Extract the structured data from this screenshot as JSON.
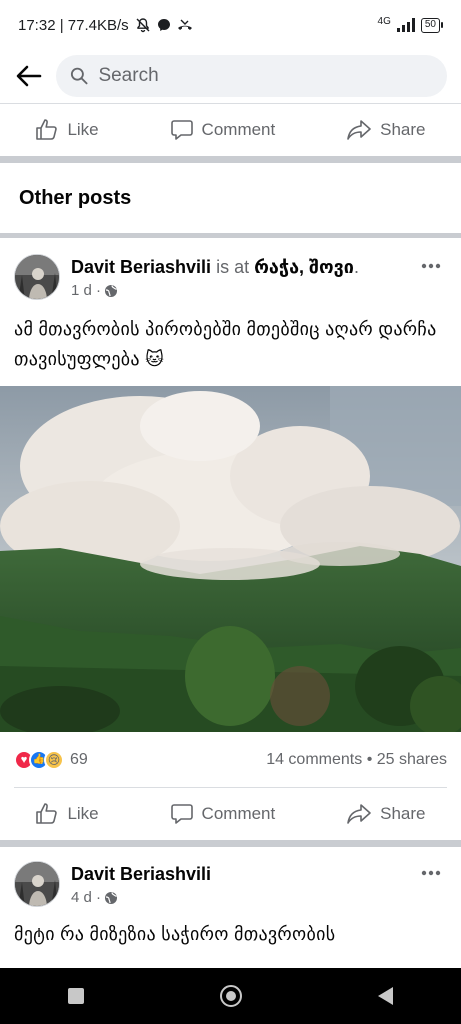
{
  "status": {
    "time_net": "17:32 | 77.4KB/s",
    "network": "4G",
    "battery": "50"
  },
  "search": {
    "placeholder": "Search"
  },
  "actions": {
    "like": "Like",
    "comment": "Comment",
    "share": "Share"
  },
  "section": {
    "title": "Other posts"
  },
  "posts": [
    {
      "author": "Davit Beriashvili",
      "is_at": "is at",
      "location": "რაჭა, შოვი",
      "location_suffix": ".",
      "time": "1 d ·",
      "text": "ამ მთავრობის პირობებში მთებშიც აღარ დარჩა თავისუფლება 🐱",
      "reaction_count": "69",
      "comments": "14 comments",
      "shares": "25 shares"
    },
    {
      "author": "Davit Beriashvili",
      "time": "4 d ·",
      "text": "მეტი რა მიზეზია საჭირო მთავრობის"
    }
  ],
  "icons": [
    "back-arrow-icon",
    "search-icon",
    "like-icon",
    "comment-icon",
    "share-icon",
    "globe-icon",
    "more-icon",
    "love-reaction-icon",
    "like-reaction-icon",
    "sad-reaction-icon"
  ],
  "colors": {
    "muted": "#65676b",
    "separator": "#c9ccd1",
    "search_bg": "#f0f2f5",
    "love": "#f02849",
    "like_blue": "#1877f2"
  }
}
